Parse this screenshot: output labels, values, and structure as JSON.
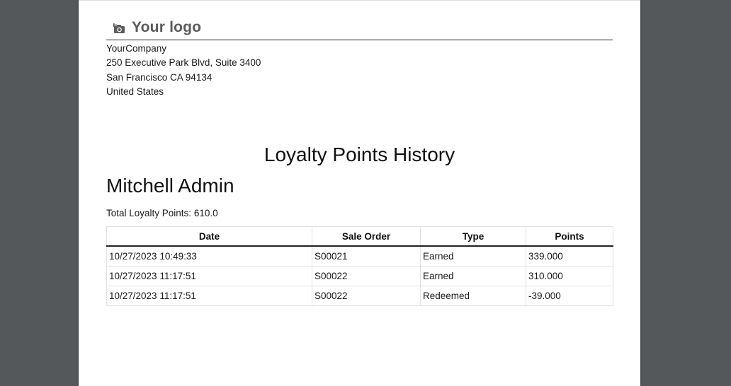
{
  "logo": {
    "text": "Your logo",
    "icon": "camera-icon"
  },
  "company": {
    "name": "YourCompany",
    "street": "250 Executive Park Blvd, Suite 3400",
    "city_line": "San Francisco CA 94134",
    "country": "United States"
  },
  "report": {
    "title": "Loyalty Points History",
    "partner": "Mitchell Admin",
    "total_label": "Total Loyalty Points: 610.0"
  },
  "table": {
    "headers": [
      "Date",
      "Sale Order",
      "Type",
      "Points"
    ],
    "rows": [
      {
        "date": "10/27/2023 10:49:33",
        "order": "S00021",
        "type": "Earned",
        "points": "339.000"
      },
      {
        "date": "10/27/2023 11:17:51",
        "order": "S00022",
        "type": "Earned",
        "points": "310.000"
      },
      {
        "date": "10/27/2023 11:17:51",
        "order": "S00022",
        "type": "Redeemed",
        "points": "-39.000"
      }
    ]
  },
  "colors": {
    "viewer_background": "#54585b",
    "page_background": "#ffffff",
    "logo_text": "#5b5b5b",
    "table_border": "#dee2e6"
  }
}
